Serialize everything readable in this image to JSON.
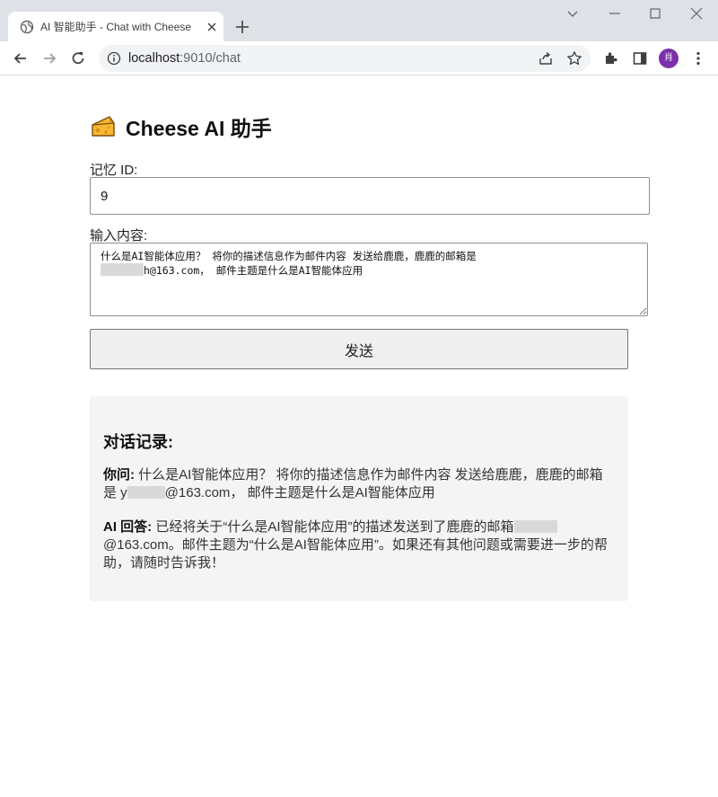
{
  "browser": {
    "tab_title": "AI 智能助手 - Chat with Cheese",
    "url_host": "localhost",
    "url_rest": ":9010/chat",
    "profile_initial": "肖"
  },
  "page": {
    "heading": "Cheese AI 助手",
    "memory_label": "记忆 ID:",
    "memory_value": "9",
    "input_label": "输入内容:",
    "input_line1": "什么是AI智能体应用？ 将你的描述信息作为邮件内容 发送给鹿鹿，鹿鹿的邮箱是",
    "input_line2_tail": "h@163.com， 邮件主题是什么是AI智能体应用",
    "send_label": "发送",
    "history_title": "对话记录:",
    "user_label": "你问:",
    "user_text_1": "什么是AI智能体应用？ 将你的描述信息作为邮件内容 发送给鹿鹿，鹿鹿的邮箱是 y",
    "user_text_2": "@163.com， 邮件主题是什么是AI智能体应用",
    "ai_label": "AI 回答:",
    "ai_text_1": "已经将关于“什么是AI智能体应用”的描述发送到了鹿鹿的邮箱",
    "ai_text_2": "@163.com。邮件主题为“什么是AI智能体应用”。如果还有其他问题或需要进一步的帮助，请随时告诉我！"
  },
  "colors": {
    "history_bg": "#f4f4f4",
    "avatar_bg": "#7b2fa8"
  }
}
